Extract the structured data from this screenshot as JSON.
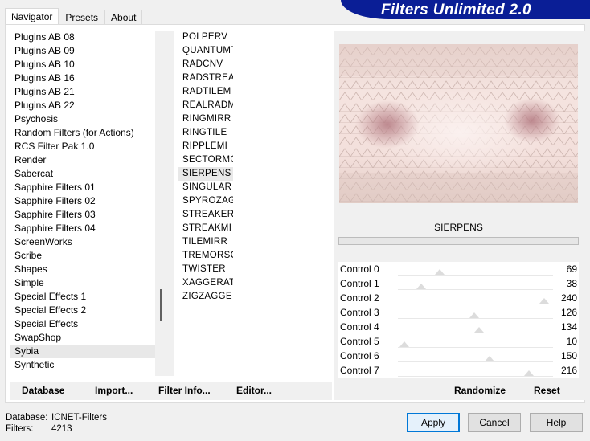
{
  "tabs": [
    {
      "label": "Navigator",
      "active": true
    },
    {
      "label": "Presets",
      "active": false
    },
    {
      "label": "About",
      "active": false
    }
  ],
  "banner": {
    "title": "Filters Unlimited 2.0"
  },
  "categories": [
    "Plugins AB 08",
    "Plugins AB 09",
    "Plugins AB 10",
    "Plugins AB 16",
    "Plugins AB 21",
    "Plugins AB 22",
    "Psychosis",
    "Random Filters (for Actions)",
    "RCS Filter Pak 1.0",
    "Render",
    "Sabercat",
    "Sapphire Filters 01",
    "Sapphire Filters 02",
    "Sapphire Filters 03",
    "Sapphire Filters 04",
    "ScreenWorks",
    "Scribe",
    "Shapes",
    "Simple",
    "Special Effects 1",
    "Special Effects 2",
    "Special Effects",
    "SwapShop",
    "Sybia",
    "Synthetic"
  ],
  "selected_category": "Sybia",
  "filters": [
    "POLPERV",
    "QUANTUMT",
    "RADCNV",
    "RADSTREA",
    "RADTILEM",
    "REALRADM",
    "RINGMIRR",
    "RINGTILE",
    "RIPPLEMI",
    "SECTORMO",
    "SIERPENS",
    "SINGULAR",
    "SPYROZAG",
    "STREAKER",
    "STREAKMI",
    "TILEMIRR",
    "TREMORSC",
    "TWISTER",
    "XAGGERAT",
    "ZIGZAGGE"
  ],
  "selected_filter": "SIERPENS",
  "filter_name": "SIERPENS",
  "controls": [
    {
      "label": "Control 0",
      "value": "69"
    },
    {
      "label": "Control 1",
      "value": "38"
    },
    {
      "label": "Control 2",
      "value": "240"
    },
    {
      "label": "Control 3",
      "value": "126"
    },
    {
      "label": "Control 4",
      "value": "134"
    },
    {
      "label": "Control 5",
      "value": "10"
    },
    {
      "label": "Control 6",
      "value": "150"
    },
    {
      "label": "Control 7",
      "value": "216"
    }
  ],
  "bottom_links": {
    "database": "Database",
    "import": "Import...",
    "filter_info": "Filter Info...",
    "editor": "Editor...",
    "randomize": "Randomize",
    "reset": "Reset"
  },
  "status": {
    "database_key": "Database:",
    "database_value": "ICNET-Filters",
    "filters_key": "Filters:",
    "filters_value": "4213"
  },
  "buttons": {
    "apply": "Apply",
    "cancel": "Cancel",
    "help": "Help"
  },
  "colors": {
    "banner": "#0a1e96",
    "selection": "#e8e8e8"
  }
}
